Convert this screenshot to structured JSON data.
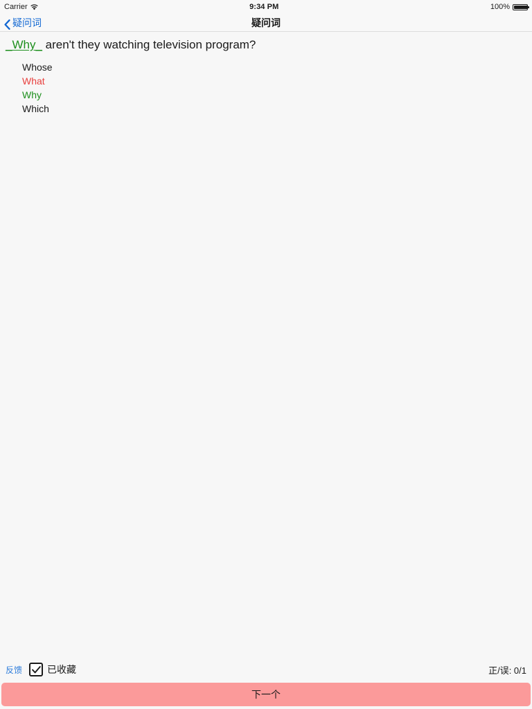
{
  "status_bar": {
    "carrier": "Carrier",
    "wifi_icon": "wifi-icon",
    "time": "9:34 PM",
    "battery_percent": "100%",
    "battery_icon": "battery-icon",
    "battery_level": 100
  },
  "nav_bar": {
    "back_icon": "chevron-left-icon",
    "back_label": "疑问词",
    "title": "疑问词"
  },
  "question": {
    "answer_token": "_Why_",
    "rest": " aren't they watching television program?",
    "answer_color": "#1d8f1d"
  },
  "options": [
    {
      "label": "Whose",
      "state": "neutral"
    },
    {
      "label": "What",
      "state": "wrong"
    },
    {
      "label": "Why",
      "state": "correct"
    },
    {
      "label": "Which",
      "state": "neutral"
    }
  ],
  "bottom_bar": {
    "feedback_label": "反馈",
    "favorite_checkbox_icon": "checkbox-checked-icon",
    "favorite_label": "已收藏",
    "favorite_checked": true,
    "score_label": "正/误: 0/1"
  },
  "next_button": {
    "label": "下一个",
    "color": "#fb9a9a"
  },
  "colors": {
    "accent_blue": "#1268d3",
    "correct_green": "#1d8f1d",
    "wrong_red": "#e8403e",
    "button_pink": "#fb9a9a",
    "background": "#f7f7f7",
    "bar_background": "#f8f8f8"
  }
}
